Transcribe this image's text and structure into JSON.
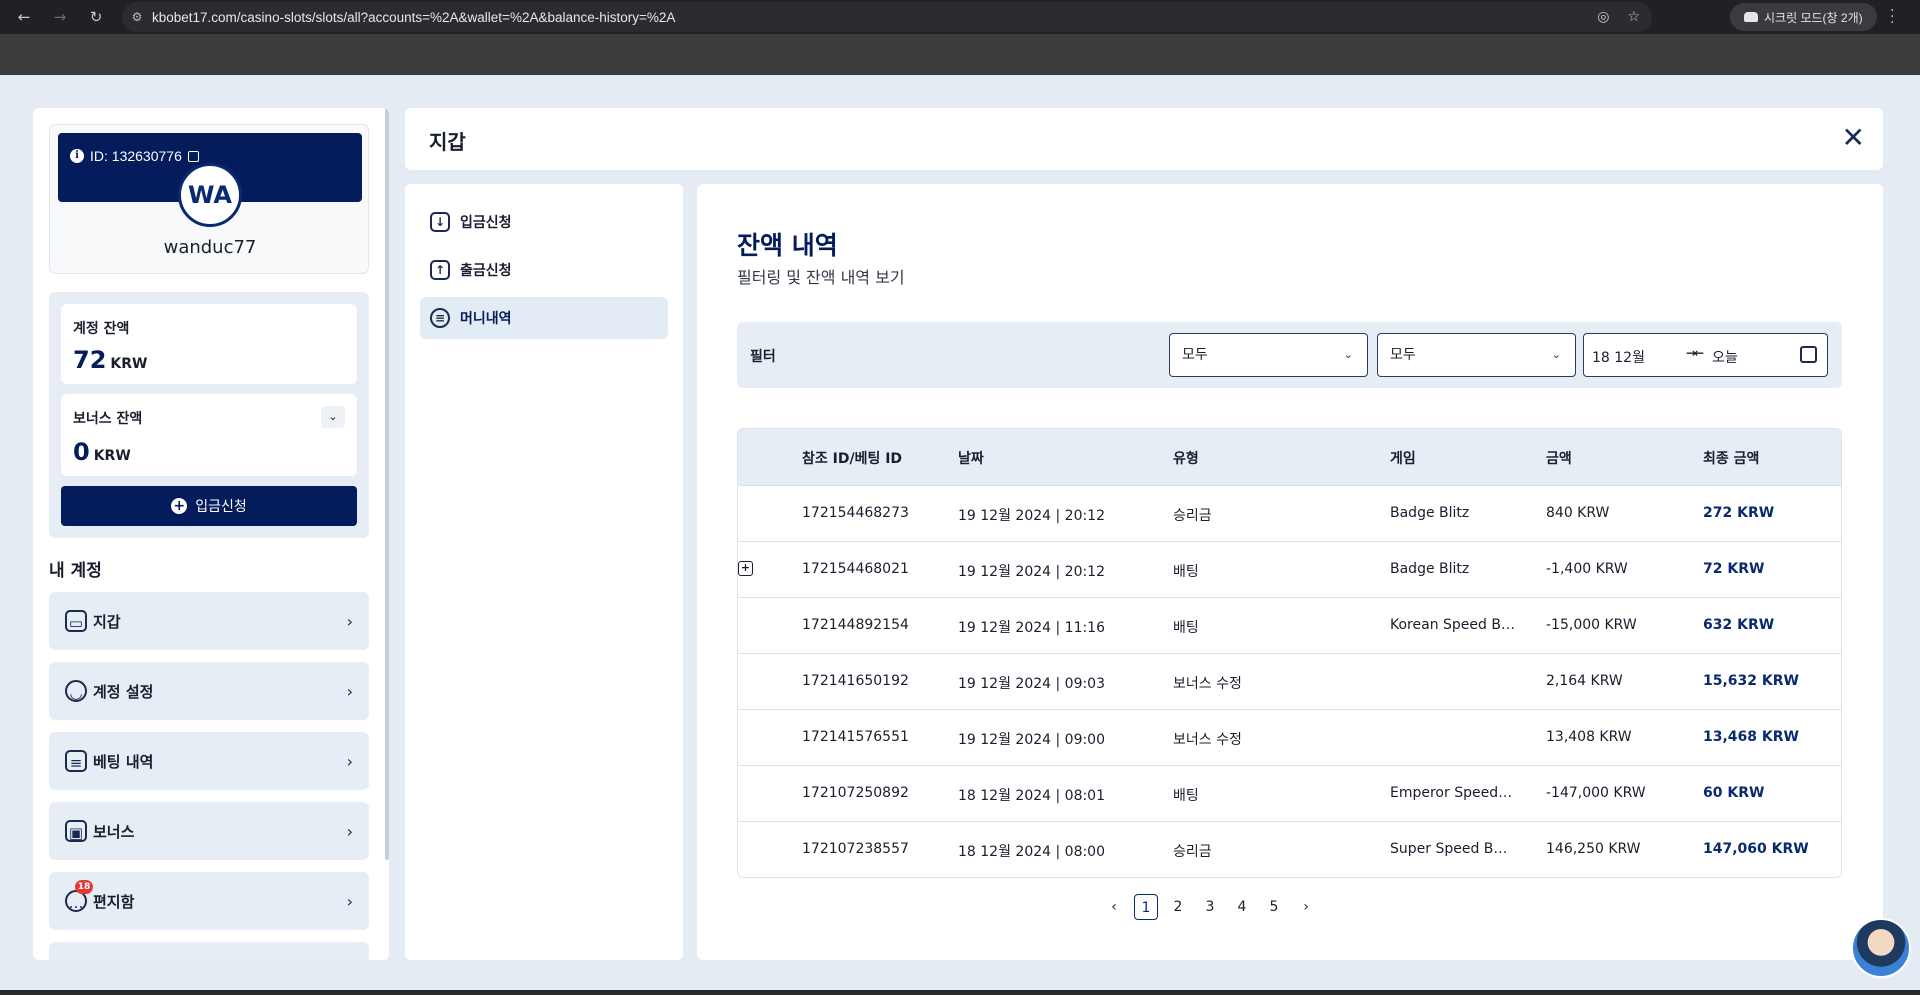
{
  "browser": {
    "url": "kbobet17.com/casino-slots/slots/all?accounts=%2A&wallet=%2A&balance-history=%2A",
    "incognito_label": "시크릿 모드(창 2개)"
  },
  "profile": {
    "id_text": "ID: 132630776",
    "avatar_initials": "WA",
    "username": "wanduc77"
  },
  "balances": {
    "account_label": "계정 잔액",
    "account_value": "72",
    "account_unit": "KRW",
    "bonus_label": "보너스 잔액",
    "bonus_value": "0",
    "bonus_unit": "KRW",
    "deposit_button": "입금신청"
  },
  "my_account": {
    "title": "내 계정",
    "items": [
      {
        "label": "지갑",
        "icon": "wallet-icon"
      },
      {
        "label": "계정 설정",
        "icon": "user-settings-icon"
      },
      {
        "label": "베팅 내역",
        "icon": "receipt-icon"
      },
      {
        "label": "보너스",
        "icon": "gift-icon"
      },
      {
        "label": "편지함",
        "icon": "chat-icon",
        "badge": "18"
      }
    ]
  },
  "panel": {
    "title": "지갑"
  },
  "subnav": [
    {
      "label": "입금신청",
      "icon": "download-icon"
    },
    {
      "label": "출금신청",
      "icon": "upload-icon"
    },
    {
      "label": "머니내역",
      "icon": "document-icon",
      "active": true
    }
  ],
  "content": {
    "title": "잔액 내역",
    "subtitle": "필터링 및 잔액 내역 보기",
    "filter": {
      "label": "필터",
      "select1": "모두",
      "select2": "모두",
      "date_from": "18 12월",
      "date_to": "오늘"
    },
    "table": {
      "headers": [
        "참조 ID/베팅 ID",
        "날짜",
        "유형",
        "게임",
        "금액",
        "최종 금액"
      ],
      "rows": [
        {
          "id": "172154468273",
          "date": "19 12월 2024 | 20:12",
          "type": "승리금",
          "game": "Badge Blitz",
          "amount": "840 KRW",
          "final": "272 KRW"
        },
        {
          "id": "172154468021",
          "date": "19 12월 2024 | 20:12",
          "type": "배팅",
          "game": "Badge Blitz",
          "amount": "-1,400 KRW",
          "final": "72 KRW"
        },
        {
          "id": "172144892154",
          "date": "19 12월 2024 | 11:16",
          "type": "배팅",
          "game": "Korean Speed B…",
          "amount": "-15,000 KRW",
          "final": "632 KRW"
        },
        {
          "id": "172141650192",
          "date": "19 12월 2024 | 09:03",
          "type": "보너스 수정",
          "game": "",
          "amount": "2,164 KRW",
          "final": "15,632 KRW"
        },
        {
          "id": "172141576551",
          "date": "19 12월 2024 | 09:00",
          "type": "보너스 수정",
          "game": "",
          "amount": "13,408 KRW",
          "final": "13,468 KRW"
        },
        {
          "id": "172107250892",
          "date": "18 12월 2024 | 08:01",
          "type": "배팅",
          "game": "Emperor Speed …",
          "amount": "-147,000 KRW",
          "final": "60 KRW"
        },
        {
          "id": "172107238557",
          "date": "18 12월 2024 | 08:00",
          "type": "승리금",
          "game": "Super Speed Ba…",
          "amount": "146,250 KRW",
          "final": "147,060 KRW"
        }
      ]
    },
    "pagination": {
      "pages": [
        "1",
        "2",
        "3",
        "4",
        "5"
      ],
      "current": "1",
      "prev": "‹",
      "next": "›"
    }
  }
}
